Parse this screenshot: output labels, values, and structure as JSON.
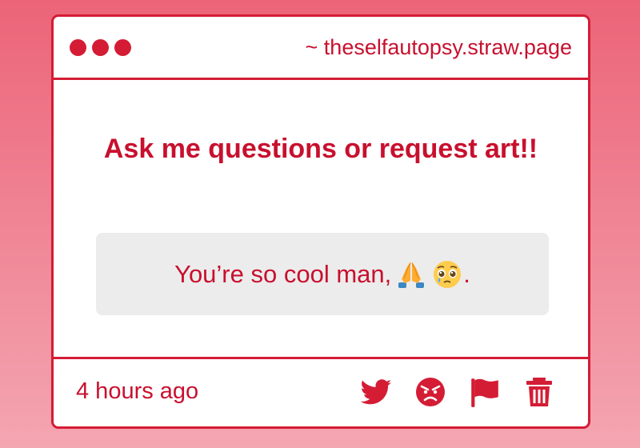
{
  "window": {
    "url": "~ theselfautopsy.straw.page"
  },
  "content": {
    "prompt": "Ask me questions or request art!!",
    "answer_text": "You’re so cool man,",
    "answer_emojis": [
      "folded-hands",
      "pleading-face"
    ],
    "answer_suffix": "."
  },
  "footer": {
    "timestamp": "4 hours ago",
    "actions": [
      "twitter-icon",
      "angry-face-icon",
      "flag-icon",
      "trash-icon"
    ]
  },
  "colors": {
    "accent": "#d41c35",
    "text": "#c8102e",
    "answer_bg": "#ececec"
  }
}
